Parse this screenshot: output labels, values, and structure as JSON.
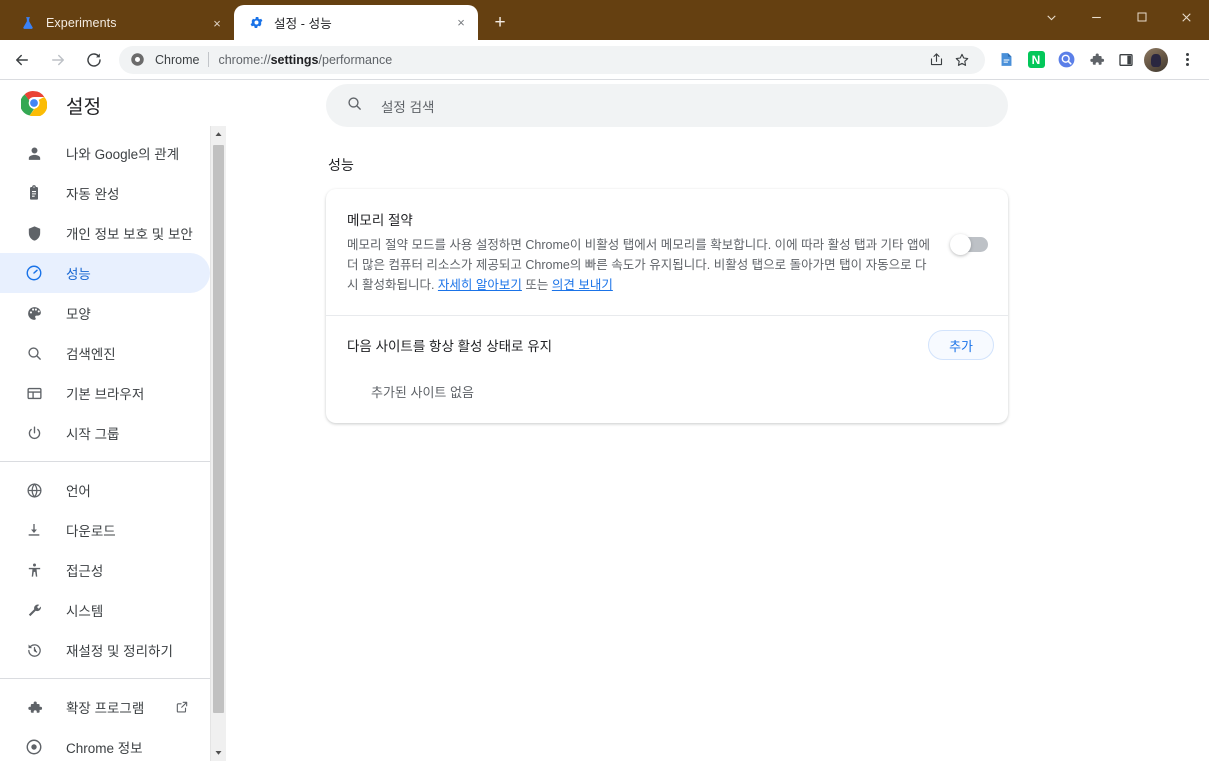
{
  "window": {
    "theme_color": "#654011",
    "controls": [
      {
        "name": "tab-search-button",
        "glyph": "chevron-down-icon"
      },
      {
        "name": "minimize-button",
        "glyph": "minimize-icon"
      },
      {
        "name": "maximize-button",
        "glyph": "maximize-icon"
      },
      {
        "name": "close-window-button",
        "glyph": "close-icon"
      }
    ]
  },
  "tabs": [
    {
      "title": "Experiments",
      "favicon": "flask-icon",
      "active": false,
      "close_label": "×"
    },
    {
      "title": "설정 - 성능",
      "favicon": "gear-icon",
      "active": true,
      "close_label": "×"
    }
  ],
  "newtab_label": "+",
  "toolbar": {
    "back_label": "←",
    "forward_label": "→",
    "reload_label": "⟳",
    "omnibox": {
      "chip": "Chrome",
      "url_prefix": "chrome://",
      "url_bold": "settings",
      "url_suffix": "/performance",
      "site_icon": "chrome-logo-icon"
    },
    "share_icon": "share-icon",
    "bookmark_icon": "star-icon",
    "extensions": [
      {
        "name": "extension-icon-blue-doc",
        "label": ""
      },
      {
        "name": "extension-icon-naver",
        "label": "N"
      },
      {
        "name": "extension-icon-search-circle",
        "label": ""
      }
    ],
    "puzzle_icon": "puzzle-icon",
    "sidepanel_icon": "side-panel-icon",
    "avatar_name": "profile-avatar",
    "menu_icon": "kebab-menu-icon"
  },
  "sidebar": {
    "brand": "설정",
    "brand_icon": "chrome-logo-icon",
    "groups": [
      {
        "items": [
          {
            "label": "나와 Google의 관계",
            "icon": "person-icon",
            "selected": false
          },
          {
            "label": "자동 완성",
            "icon": "clipboard-icon",
            "selected": false
          },
          {
            "label": "개인 정보 보호 및 보안",
            "icon": "shield-icon",
            "selected": false
          },
          {
            "label": "성능",
            "icon": "speedometer-icon",
            "selected": true
          },
          {
            "label": "모양",
            "icon": "palette-icon",
            "selected": false
          },
          {
            "label": "검색엔진",
            "icon": "search-icon",
            "selected": false
          },
          {
            "label": "기본 브라우저",
            "icon": "browser-icon",
            "selected": false
          },
          {
            "label": "시작 그룹",
            "icon": "power-icon",
            "selected": false
          }
        ]
      },
      {
        "items": [
          {
            "label": "언어",
            "icon": "globe-icon",
            "selected": false
          },
          {
            "label": "다운로드",
            "icon": "download-icon",
            "selected": false
          },
          {
            "label": "접근성",
            "icon": "accessibility-icon",
            "selected": false
          },
          {
            "label": "시스템",
            "icon": "wrench-icon",
            "selected": false
          },
          {
            "label": "재설정 및 정리하기",
            "icon": "restore-icon",
            "selected": false
          }
        ]
      },
      {
        "items": [
          {
            "label": "확장 프로그램",
            "icon": "puzzle-icon",
            "selected": false,
            "external": true
          },
          {
            "label": "Chrome 정보",
            "icon": "chrome-circle-icon",
            "selected": false
          }
        ]
      }
    ]
  },
  "search": {
    "placeholder": "설정 검색",
    "value": "",
    "icon": "search-icon"
  },
  "main": {
    "section_title": "성능",
    "memory_saver": {
      "title": "메모리 절약",
      "desc_part1": "메모리 절약 모드를 사용 설정하면 Chrome이 비활성 탭에서 메모리를 확보합니다. 이에 따라 활성 탭과 기타 앱에 더 많은 컴퓨터 리소스가 제공되고 Chrome의 빠른 속도가 유지됩니다. 비활성 탭으로 돌아가면 탭이 자동으로 다시 활성화됩니다. ",
      "link_learn_more": "자세히 알아보기",
      "desc_or": " 또는 ",
      "link_feedback": "의견 보내기",
      "toggle_on": false
    },
    "keep_active": {
      "label": "다음 사이트를 항상 활성 상태로 유지",
      "add_button": "추가",
      "empty_text": "추가된 사이트 없음"
    }
  },
  "colors": {
    "theme": "#654011",
    "accent": "#1a73e8",
    "selected_bg": "#e8f0fe",
    "selected_fg": "#1967d2",
    "text_primary": "#202124",
    "text_secondary": "#5f6368"
  }
}
